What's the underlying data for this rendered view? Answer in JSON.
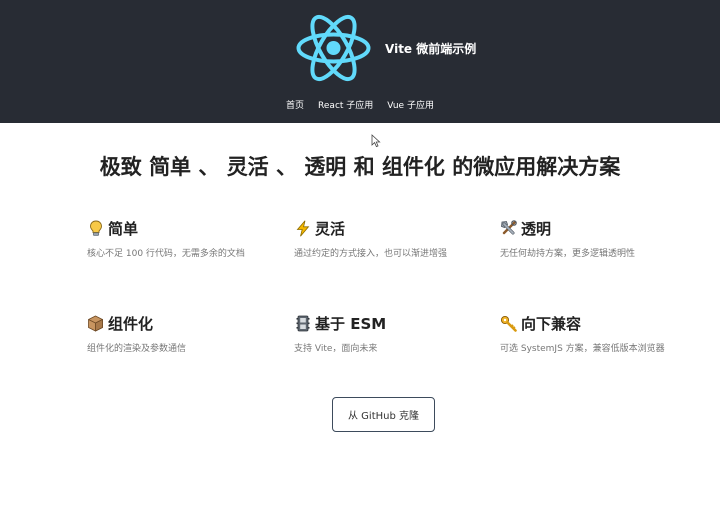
{
  "header": {
    "brand_title": "Vite 微前端示例",
    "nav": [
      {
        "label": "首页"
      },
      {
        "label": "React 子应用"
      },
      {
        "label": "Vue 子应用"
      }
    ]
  },
  "hero": {
    "p1": "极致 ",
    "k1": "简单",
    "sep1": " 、 ",
    "k2": "灵活",
    "sep2": " 、 ",
    "k3": "透明",
    "p2": " 和 ",
    "k4": "组件化",
    "p3": " 的微应用解决方案"
  },
  "features": [
    {
      "icon": "lightbulb-icon",
      "title": "简单",
      "desc": "核心不足 100 行代码，无需多余的文档"
    },
    {
      "icon": "lightning-icon",
      "title": "灵活",
      "desc": "通过约定的方式接入，也可以渐进增强"
    },
    {
      "icon": "tools-icon",
      "title": "透明",
      "desc": "无任何劫持方案，更多逻辑透明性"
    },
    {
      "icon": "package-icon",
      "title": "组件化",
      "desc": "组件化的渲染及参数通信"
    },
    {
      "icon": "film-icon",
      "title": "基于 ESM",
      "desc": "支持 Vite，面向未来"
    },
    {
      "icon": "key-icon",
      "title": "向下兼容",
      "desc": "可选 SystemJS 方案，兼容低版本浏览器"
    }
  ],
  "clone_button": {
    "label": "从 GitHub 克隆"
  },
  "colors": {
    "header_bg": "#282c34",
    "react_logo": "#61dafb"
  }
}
